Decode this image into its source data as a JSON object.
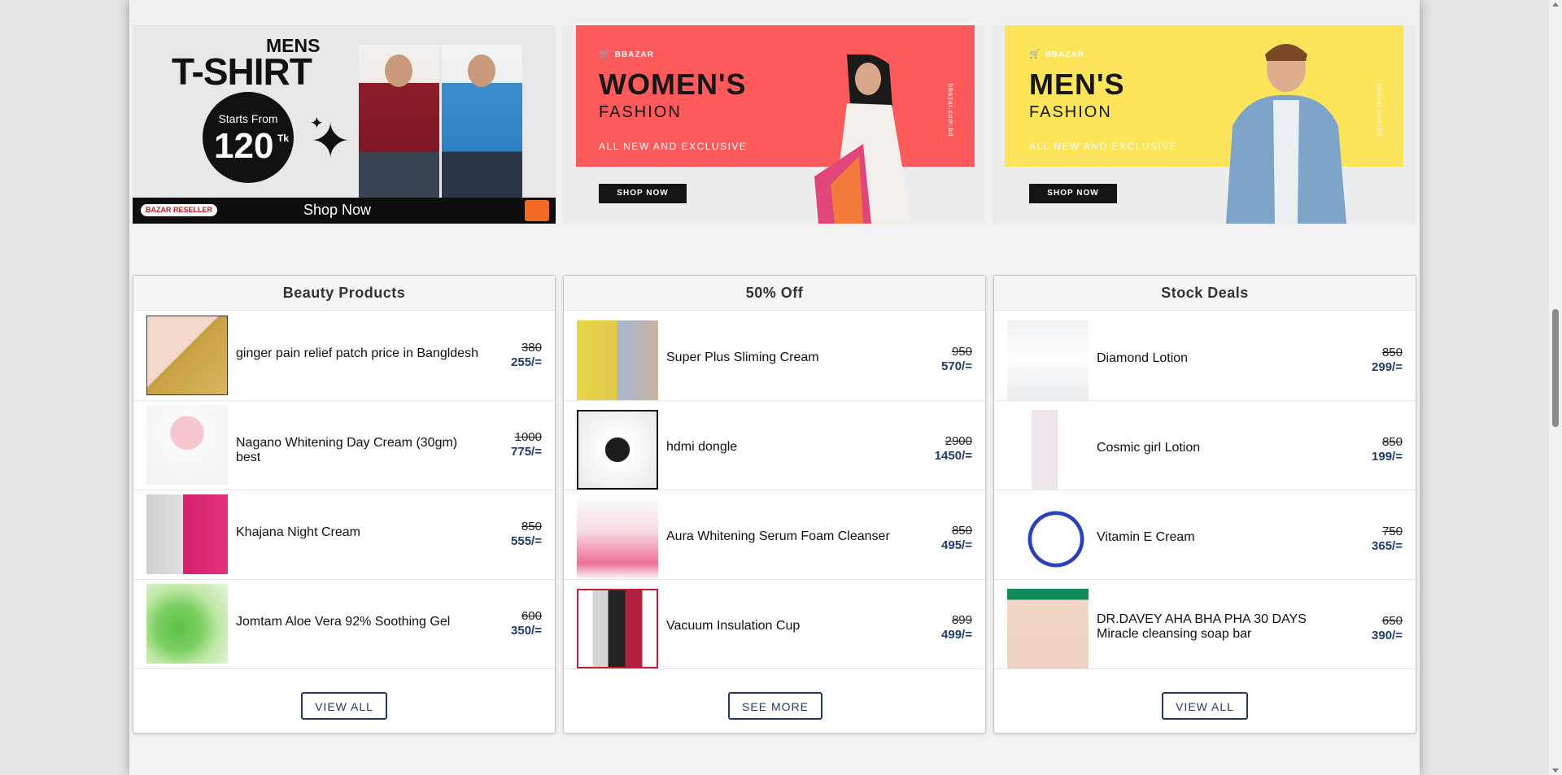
{
  "banners": {
    "tshirt": {
      "mens": "MENS",
      "title": "T-SHIRT",
      "starts_from": "Starts From",
      "price": "120",
      "currency": "Tk",
      "reseller": "BAZAR RESELLER",
      "shop_now": "Shop Now"
    },
    "womens": {
      "brand": "BBAZAR",
      "title": "WOMEN'S",
      "subtitle": "FASHION",
      "tagline": "ALL NEW AND EXCLUSIVE",
      "button": "SHOP NOW",
      "vertical": "bbazar.com.bd",
      "bg_color": "#fd5a5c"
    },
    "mens": {
      "brand": "BBAZAR",
      "title": "MEN'S",
      "subtitle": "FASHION",
      "tagline": "ALL NEW AND EXCLUSIVE",
      "button": "SHOP NOW",
      "vertical": "bbazar.com.bd",
      "bg_color": "#fce55b"
    }
  },
  "cards": [
    {
      "title": "Beauty Products",
      "button": "VIEW ALL",
      "products": [
        {
          "name": "ginger pain relief patch price in Bangldesh",
          "old_price": "380",
          "new_price": "255/=",
          "image": "ginger-patch"
        },
        {
          "name": "Nagano Whitening Day Cream (30gm) best",
          "old_price": "1000",
          "new_price": "775/=",
          "image": "cream-jar"
        },
        {
          "name": "Khajana Night Cream",
          "old_price": "850",
          "new_price": "555/=",
          "image": "night-cream-box"
        },
        {
          "name": "Jomtam Aloe Vera 92% Soothing Gel",
          "old_price": "600",
          "new_price": "350/=",
          "image": "aloe-gel"
        }
      ]
    },
    {
      "title": "50% Off",
      "button": "SEE MORE",
      "products": [
        {
          "name": "Super Plus Sliming Cream",
          "old_price": "950",
          "new_price": "570/=",
          "image": "sliming-cream"
        },
        {
          "name": "hdmi dongle",
          "old_price": "2900",
          "new_price": "1450/=",
          "image": "hdmi-dongle"
        },
        {
          "name": "Aura Whitening Serum Foam Cleanser",
          "old_price": "850",
          "new_price": "495/=",
          "image": "foam-cleanser"
        },
        {
          "name": "Vacuum Insulation Cup",
          "old_price": "899",
          "new_price": "499/=",
          "image": "insulation-cup"
        }
      ]
    },
    {
      "title": "Stock Deals",
      "button": "VIEW ALL",
      "products": [
        {
          "name": "Diamond Lotion",
          "old_price": "850",
          "new_price": "299/=",
          "image": "lotion-bottle"
        },
        {
          "name": "Cosmic girl Lotion",
          "old_price": "850",
          "new_price": "199/=",
          "image": "cosmic-lotion"
        },
        {
          "name": "Vitamin E Cream",
          "old_price": "750",
          "new_price": "365/=",
          "image": "vitamin-e-jar"
        },
        {
          "name": "DR.DAVEY AHA BHA PHA 30 DAYS Miracle cleansing soap bar",
          "old_price": "650",
          "new_price": "390/=",
          "image": "soap-bar"
        }
      ]
    }
  ]
}
